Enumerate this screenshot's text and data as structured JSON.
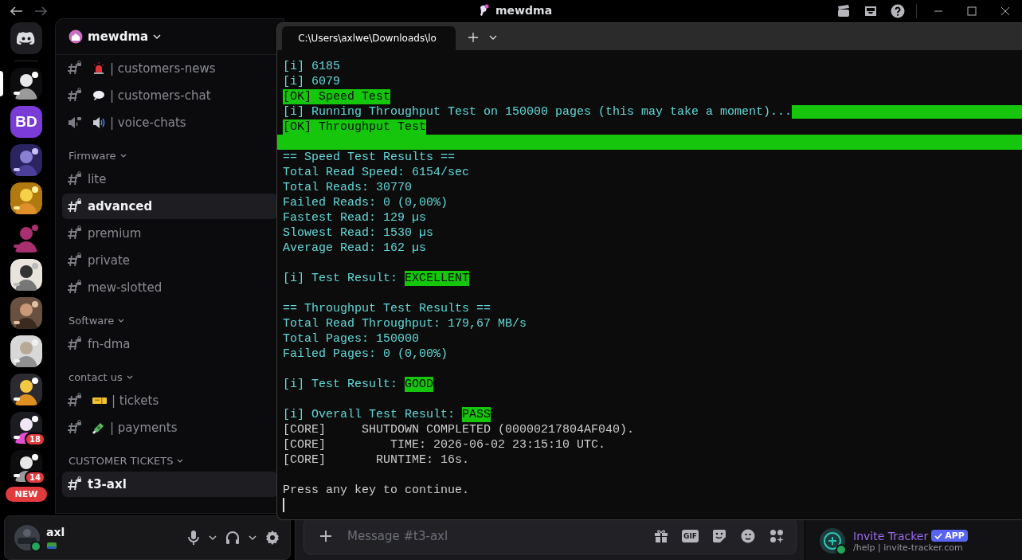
{
  "titlebar": {
    "title": "mewdma"
  },
  "servers": [
    {
      "kind": "home",
      "selected": false
    },
    {
      "kind": "picture",
      "selected": true
    },
    {
      "kind": "initials",
      "text": "BD",
      "selected": false
    },
    {
      "kind": "picture",
      "selected": false
    },
    {
      "kind": "picture",
      "selected": false
    },
    {
      "kind": "picture",
      "selected": false
    },
    {
      "kind": "picture",
      "selected": false
    },
    {
      "kind": "picture",
      "selected": false
    },
    {
      "kind": "picture",
      "selected": false
    },
    {
      "kind": "picture",
      "selected": false
    },
    {
      "kind": "picture",
      "selected": false,
      "badge": "18"
    },
    {
      "kind": "picture",
      "selected": false,
      "badge": "14"
    }
  ],
  "new_pill": "NEW",
  "sidebar": {
    "server_name": "mewdma",
    "groups": [
      {
        "channels": [
          {
            "kind": "text",
            "name": "| customers-news",
            "emoji": true,
            "selected": false
          },
          {
            "kind": "text",
            "name": "| customers-chat",
            "emoji": true,
            "selected": false
          },
          {
            "kind": "voice",
            "name": "| voice-chats",
            "emoji": true,
            "selected": false
          }
        ]
      },
      {
        "category": "Firmware",
        "channels": [
          {
            "kind": "text",
            "name": "lite",
            "emoji": false,
            "selected": false
          },
          {
            "kind": "text",
            "name": "advanced",
            "emoji": false,
            "selected": true
          },
          {
            "kind": "text",
            "name": "premium",
            "emoji": false,
            "selected": false
          },
          {
            "kind": "text",
            "name": "private",
            "emoji": false,
            "selected": false
          },
          {
            "kind": "text",
            "name": "mew-slotted",
            "emoji": false,
            "selected": false
          }
        ]
      },
      {
        "category": "Software",
        "channels": [
          {
            "kind": "text",
            "name": "fn-dma",
            "emoji": false,
            "selected": false
          }
        ]
      },
      {
        "category": "contact us",
        "channels": [
          {
            "kind": "text",
            "name": "| tickets",
            "emoji": true,
            "selected": false
          },
          {
            "kind": "text",
            "name": "| payments",
            "emoji": true,
            "selected": false
          }
        ]
      },
      {
        "category": "CUSTOMER TICKETS",
        "channels": [
          {
            "kind": "text",
            "name": "t3-axl",
            "emoji": false,
            "selected": true
          }
        ]
      }
    ]
  },
  "user": {
    "name": "axl"
  },
  "message_bar": {
    "placeholder": "Message #t3-axl",
    "gif_label": "GIF"
  },
  "member": {
    "name": "Invite Tracker",
    "tag": "APP",
    "status": "/help | invite-tracker.com"
  },
  "terminal": {
    "tab_title": "C:\\Users\\axlwe\\Downloads\\lo",
    "cursor": true,
    "lines": [
      {
        "kind": "info",
        "text": "[i] 6185"
      },
      {
        "kind": "info",
        "text": "[i] 6079"
      },
      {
        "kind": "ok",
        "text": "[OK] Speed Test"
      },
      {
        "kind": "info",
        "text": "[i] Running Throughput Test on 150000 pages (this may take a moment)...",
        "tail_bar": true,
        "level": 1
      },
      {
        "kind": "ok",
        "text": "[OK] Throughput Test"
      },
      {
        "kind": "fill",
        "level": 1
      },
      {
        "kind": "info",
        "text": "== Speed Test Results =="
      },
      {
        "kind": "info",
        "text": "Total Read Speed: 6154/sec"
      },
      {
        "kind": "info",
        "text": "Total Reads: 30770"
      },
      {
        "kind": "info",
        "text": "Failed Reads: 0 (0,00%)"
      },
      {
        "kind": "info",
        "text": "Fastest Read: 129 µs"
      },
      {
        "kind": "info",
        "text": "Slowest Read: 1530 µs"
      },
      {
        "kind": "info",
        "text": "Average Read: 162 µs"
      },
      {
        "kind": "blank"
      },
      {
        "kind": "info",
        "text": "[i] Test Result: ",
        "badge": "EXCELLENT"
      },
      {
        "kind": "blank"
      },
      {
        "kind": "info",
        "text": "== Throughput Test Results =="
      },
      {
        "kind": "info",
        "text": "Total Read Throughput: 179,67 MB/s"
      },
      {
        "kind": "info",
        "text": "Total Pages: 150000"
      },
      {
        "kind": "info",
        "text": "Failed Pages: 0 (0,00%)"
      },
      {
        "kind": "blank"
      },
      {
        "kind": "info",
        "text": "[i] Test Result: ",
        "badge": "GOOD"
      },
      {
        "kind": "blank"
      },
      {
        "kind": "info",
        "text": "[i] Overall Test Result: ",
        "badge": "PASS"
      },
      {
        "kind": "plain",
        "text": "[CORE]     SHUTDOWN COMPLETED (00000217804AF040)."
      },
      {
        "kind": "plain",
        "text": "[CORE]         TIME: 2026-06-02 23:15:10 UTC."
      },
      {
        "kind": "plain",
        "text": "[CORE]       RUNTIME: 16s."
      },
      {
        "kind": "blank"
      },
      {
        "kind": "plain",
        "text": "Press any key to continue."
      }
    ]
  }
}
